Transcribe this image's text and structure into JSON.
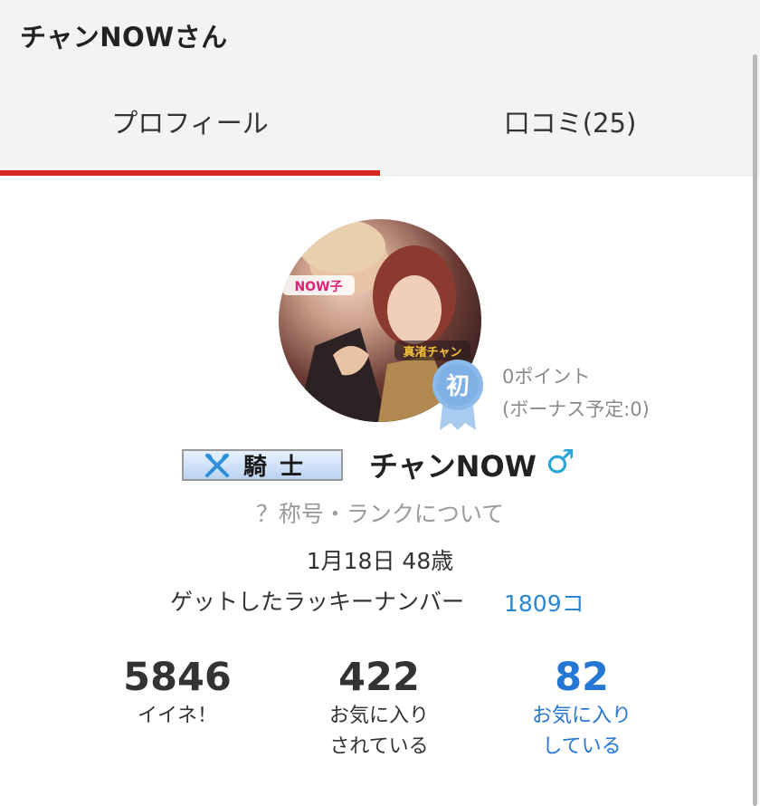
{
  "header": {
    "title": "チャンNOWさん"
  },
  "tabs": [
    {
      "label": "プロフィール",
      "active": true
    },
    {
      "label": "口コミ(25)",
      "active": false
    }
  ],
  "profile": {
    "badge_char": "初",
    "points": "0ポイント",
    "bonus": "(ボーナス予定:0)",
    "rank": "騎士",
    "rank_icon": "crossed-axes-icon",
    "username": "チャンNOW",
    "gender_symbol": "♂",
    "rank_info_link": "？称号・ランクについて",
    "birthday_age": "1月18日 48歳",
    "lucky_label": "ゲットしたラッキーナンバー",
    "lucky_value": "1809コ",
    "avatar_captions": [
      "NOW子",
      "真渚チャン"
    ]
  },
  "stats": [
    {
      "value": "5846",
      "label_line1": "イイネ！",
      "label_line2": ""
    },
    {
      "value": "422",
      "label_line1": "お気に入り",
      "label_line2": "されている"
    },
    {
      "value": "82",
      "label_line1": "お気に入り",
      "label_line2": "している"
    }
  ],
  "colors": {
    "accent_red": "#d5281e",
    "link_blue": "#2577d6",
    "gender_blue": "#2ba4d8",
    "header_bg": "#f3f3f3"
  }
}
